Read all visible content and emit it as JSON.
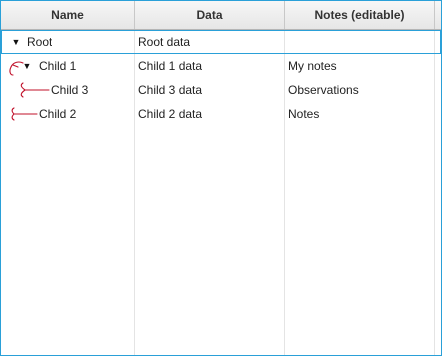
{
  "columns": {
    "name": "Name",
    "data": "Data",
    "notes": "Notes (editable)"
  },
  "rows": [
    {
      "name": "Root",
      "data": "Root data",
      "notes": "",
      "expanded": true
    },
    {
      "name": "Child 1",
      "data": "Child 1 data",
      "notes": "My notes",
      "expanded": true
    },
    {
      "name": "Child 3",
      "data": "Child 3 data",
      "notes": "Observations"
    },
    {
      "name": "Child 2",
      "data": "Child 2 data",
      "notes": "Notes"
    }
  ],
  "colors": {
    "focus_border": "#2aa0d8",
    "annotation": "#c0102a"
  },
  "icons": {
    "expanded": "triangle-down-icon",
    "annotation": "red-arrow-annotation"
  }
}
